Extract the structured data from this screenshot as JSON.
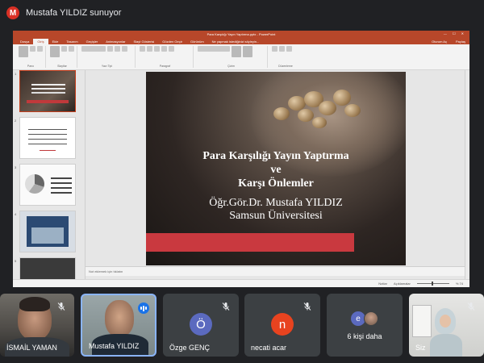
{
  "meet": {
    "presenter_initial": "M",
    "presenter_label": "Mustafa YILDIZ sunuyor"
  },
  "ppt": {
    "window_title": "Para Karşılığı Yayın Yaptırma.pptx - PowerPoint",
    "tabs": [
      "Dosya",
      "Giriş",
      "Ekle",
      "Tasarım",
      "Geçişler",
      "Animasyonlar",
      "Slayt Gösterisi",
      "Gözden Geçir",
      "Görünüm",
      "Ne yapmak istediğinizi söyleyin..."
    ],
    "active_tab": "Giriş",
    "right_actions": [
      "Oturum Aç",
      "Paylaş"
    ],
    "ribbon_groups": [
      "Pano",
      "Slaytlar",
      "Yazı Tipi",
      "Paragraf",
      "Çizim",
      "Düzenleme"
    ],
    "slide_numbers": [
      "1",
      "2",
      "3",
      "4",
      "5"
    ],
    "slide": {
      "title_line1": "Para Karşılığı Yayın Yaptırma",
      "title_line2": "ve",
      "title_line3": "Karşı Önlemler",
      "author": "Öğr.Gör.Dr. Mustafa YILDIZ",
      "institution": "Samsun Üniversitesi"
    },
    "notes_placeholder": "Not eklemek için tıklatın",
    "status_notes": "Notlar",
    "status_comments": "Açıklamalar",
    "status_zoom": "% 74"
  },
  "participants": [
    {
      "name": "İSMAİL YAMAN",
      "mic": "off"
    },
    {
      "name": "Mustafa YILDIZ",
      "mic": "speaking"
    },
    {
      "name": "Özge GENÇ",
      "initial": "Ö",
      "avatar_color": "#5b6abf",
      "mic": "off"
    },
    {
      "name": "necati acar",
      "initial": "n",
      "avatar_color": "#e8431f",
      "mic": "off"
    },
    {
      "more_label": "6 kişi daha",
      "initial": "e"
    },
    {
      "name": "Siz",
      "mic": "off"
    }
  ]
}
